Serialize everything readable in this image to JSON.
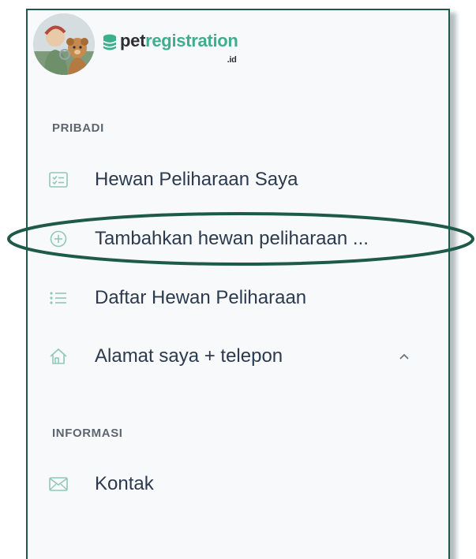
{
  "brand": {
    "logo_pet": "pet",
    "logo_registration": "registration",
    "logo_tld": ".id"
  },
  "sections": {
    "personal": "PRIBADI",
    "info": "INFORMASI"
  },
  "menu": {
    "my_pets": "Hewan Peliharaan Saya",
    "add_pet": "Tambahkan hewan peliharaan ...",
    "pet_list": "Daftar Hewan Peliharaan",
    "address": "Alamat saya + telepon",
    "contact": "Kontak"
  },
  "colors": {
    "accent": "#3fae8c",
    "border": "#1d5a48",
    "text": "#2b3a4e",
    "icon": "#8fc9b5"
  },
  "icons": {
    "my_pets": "checklist-icon",
    "add_pet": "plus-circle-icon",
    "pet_list": "list-icon",
    "address": "house-icon",
    "address_toggle": "chevron-up-icon",
    "contact": "envelope-icon"
  }
}
